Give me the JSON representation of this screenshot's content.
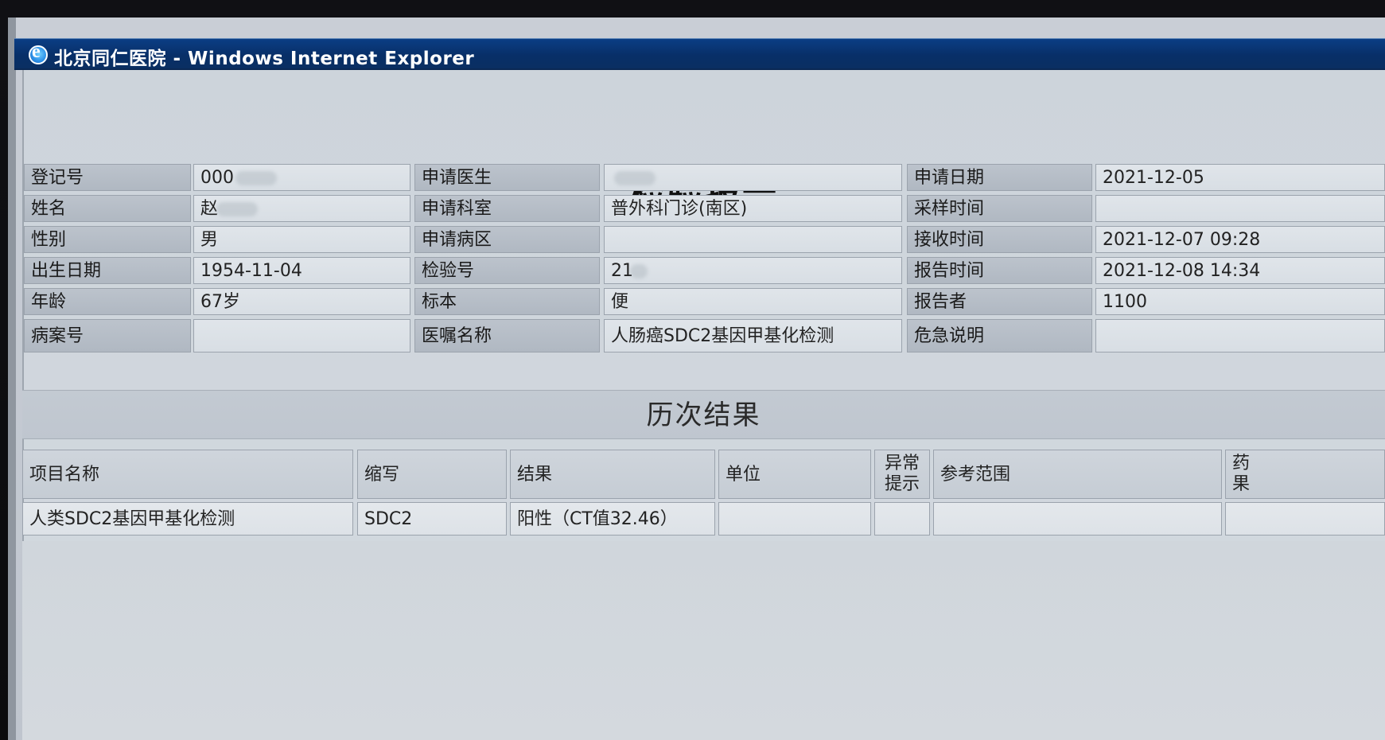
{
  "window": {
    "title": "北京同仁医院 - Windows Internet Explorer"
  },
  "report": {
    "title": "检验报告",
    "history_title": "历次结果"
  },
  "patient_info": {
    "col1": [
      {
        "label": "登记号",
        "value": "000"
      },
      {
        "label": "姓名",
        "value": "赵"
      },
      {
        "label": "性别",
        "value": "男"
      },
      {
        "label": "出生日期",
        "value": "1954-11-04"
      },
      {
        "label": "年龄",
        "value": "67岁"
      },
      {
        "label": "病案号",
        "value": ""
      }
    ],
    "col2": [
      {
        "label": "申请医生",
        "value": ""
      },
      {
        "label": "申请科室",
        "value": "普外科门诊(南区)"
      },
      {
        "label": "申请病区",
        "value": ""
      },
      {
        "label": "检验号",
        "value": "21"
      },
      {
        "label": "标本",
        "value": "便"
      },
      {
        "label": "医嘱名称",
        "value": "人肠癌SDC2基因甲基化检测"
      }
    ],
    "col3": [
      {
        "label": "申请日期",
        "value": "2021-12-05"
      },
      {
        "label": "采样时间",
        "value": ""
      },
      {
        "label": "接收时间",
        "value": "2021-12-07 09:28"
      },
      {
        "label": "报告时间",
        "value": "2021-12-08 14:34"
      },
      {
        "label": "报告者",
        "value": "1100"
      },
      {
        "label": "危急说明",
        "value": ""
      }
    ]
  },
  "results_table": {
    "headers": [
      "项目名称",
      "缩写",
      "结果",
      "单位",
      "异常\n提示",
      "参考范围",
      "药\n果"
    ],
    "rows": [
      {
        "item_name": "人类SDC2基因甲基化检测",
        "abbr": "SDC2",
        "result": "阳性（CT值32.46）",
        "unit": "",
        "abnormal": "",
        "reference": "",
        "extra": ""
      }
    ]
  }
}
